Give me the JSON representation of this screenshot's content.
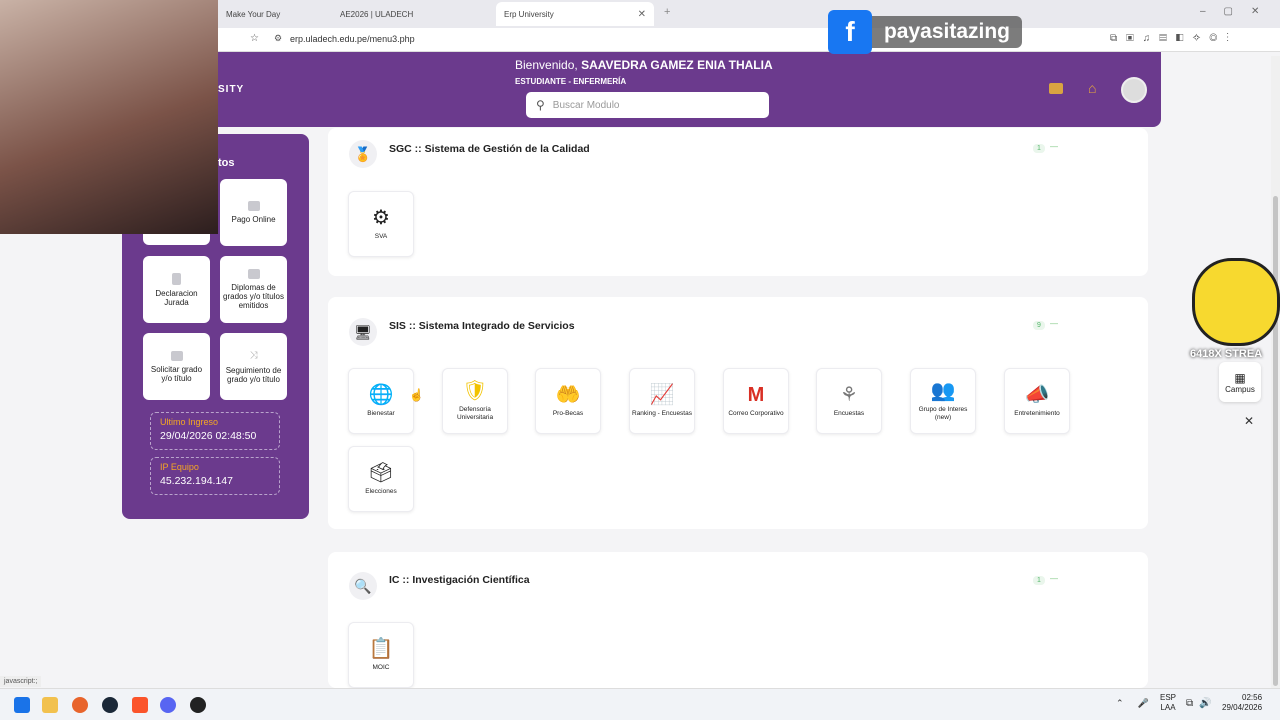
{
  "browser": {
    "tabs": [
      {
        "label": "Make Your Day"
      },
      {
        "label": "AE2026 | ULADECH"
      },
      {
        "label": "Erp University"
      }
    ],
    "url": "erp.uladech.edu.pe/menu3.php"
  },
  "header": {
    "welcome_prefix": "Bienvenido,",
    "user_name": "SAAVEDRA GAMEZ ENIA THALIA",
    "role": "ESTUDIANTE - ENFERMERÍA",
    "search_placeholder": "Buscar Modulo",
    "logo_fragment": "SITY"
  },
  "sidebar": {
    "heading_fragment": "tos",
    "buttons": [
      {
        "label": "Pago Online"
      },
      {
        "label": "Declaracion Jurada"
      },
      {
        "label": "Diplomas de grados y/o títulos emitidos"
      },
      {
        "label": "Solicitar grado y/o título"
      },
      {
        "label": "Seguimiento de grado y/o título"
      }
    ],
    "last_login": {
      "label": "Ultimo Ingreso",
      "value": "29/04/2026 02:48:50"
    },
    "ip": {
      "label": "IP Equipo",
      "value": "45.232.194.147"
    }
  },
  "sections": [
    {
      "title": "SGC :: Sistema de Gestión de la Calidad",
      "badge": "1",
      "modules": [
        {
          "label": "SVA"
        }
      ]
    },
    {
      "title": "SIS :: Sistema Integrado de Servicios",
      "badge": "9",
      "modules": [
        {
          "label": "Bienestar"
        },
        {
          "label": "Defensoría Universitaria"
        },
        {
          "label": "Pro-Becas"
        },
        {
          "label": "Ranking - Encuestas"
        },
        {
          "label": "Correo Corporativo"
        },
        {
          "label": "Encuestas"
        },
        {
          "label": "Grupo de Interes (new)"
        },
        {
          "label": "Entretenimiento"
        },
        {
          "label": "Elecciones"
        }
      ]
    },
    {
      "title": "IC :: Investigación Científica",
      "badge": "1",
      "modules": [
        {
          "label": "MOIC"
        }
      ]
    }
  ],
  "overlay": {
    "social_name": "payasitazing",
    "sticker_text": "6418X STREA",
    "campus_label": "Campus"
  },
  "statusbar": "javascript:;",
  "taskbar": {
    "lang_1": "ESP",
    "lang_2": "LAA",
    "time": "02:56",
    "date": "29/04/2026"
  }
}
